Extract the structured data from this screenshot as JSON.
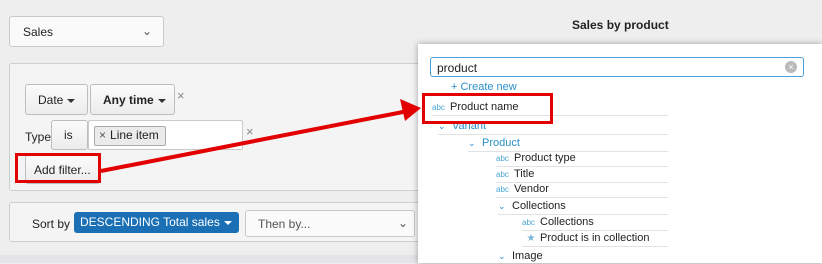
{
  "top_select": {
    "label": "Sales",
    "icon": "chevron-down-icon"
  },
  "chart_title": "Sales by product",
  "filters": {
    "date_label": "Date",
    "anytime_label": "Any time",
    "remove": "×",
    "type_label": "Type",
    "is_label": "is",
    "token_label": "Line item",
    "token_remove": "×",
    "add_filter_label": "Add filter..."
  },
  "sort": {
    "label": "Sort by",
    "value": "DESCENDING Total sales",
    "then_by_placeholder": "Then by..."
  },
  "popup": {
    "search_value": "product",
    "clear_icon": "×",
    "create_new": "+ Create new",
    "abc": "abc",
    "product_name": "Product name",
    "variant": "Variant",
    "product": "Product",
    "product_type": "Product type",
    "title": "Title",
    "vendor": "Vendor",
    "collections_group": "Collections",
    "collections": "Collections",
    "product_in_collection": "Product is in collection",
    "image": "Image"
  },
  "colors": {
    "annotation": "#e30000",
    "link": "#2a8fc8",
    "pill": "#1a6fb5"
  }
}
